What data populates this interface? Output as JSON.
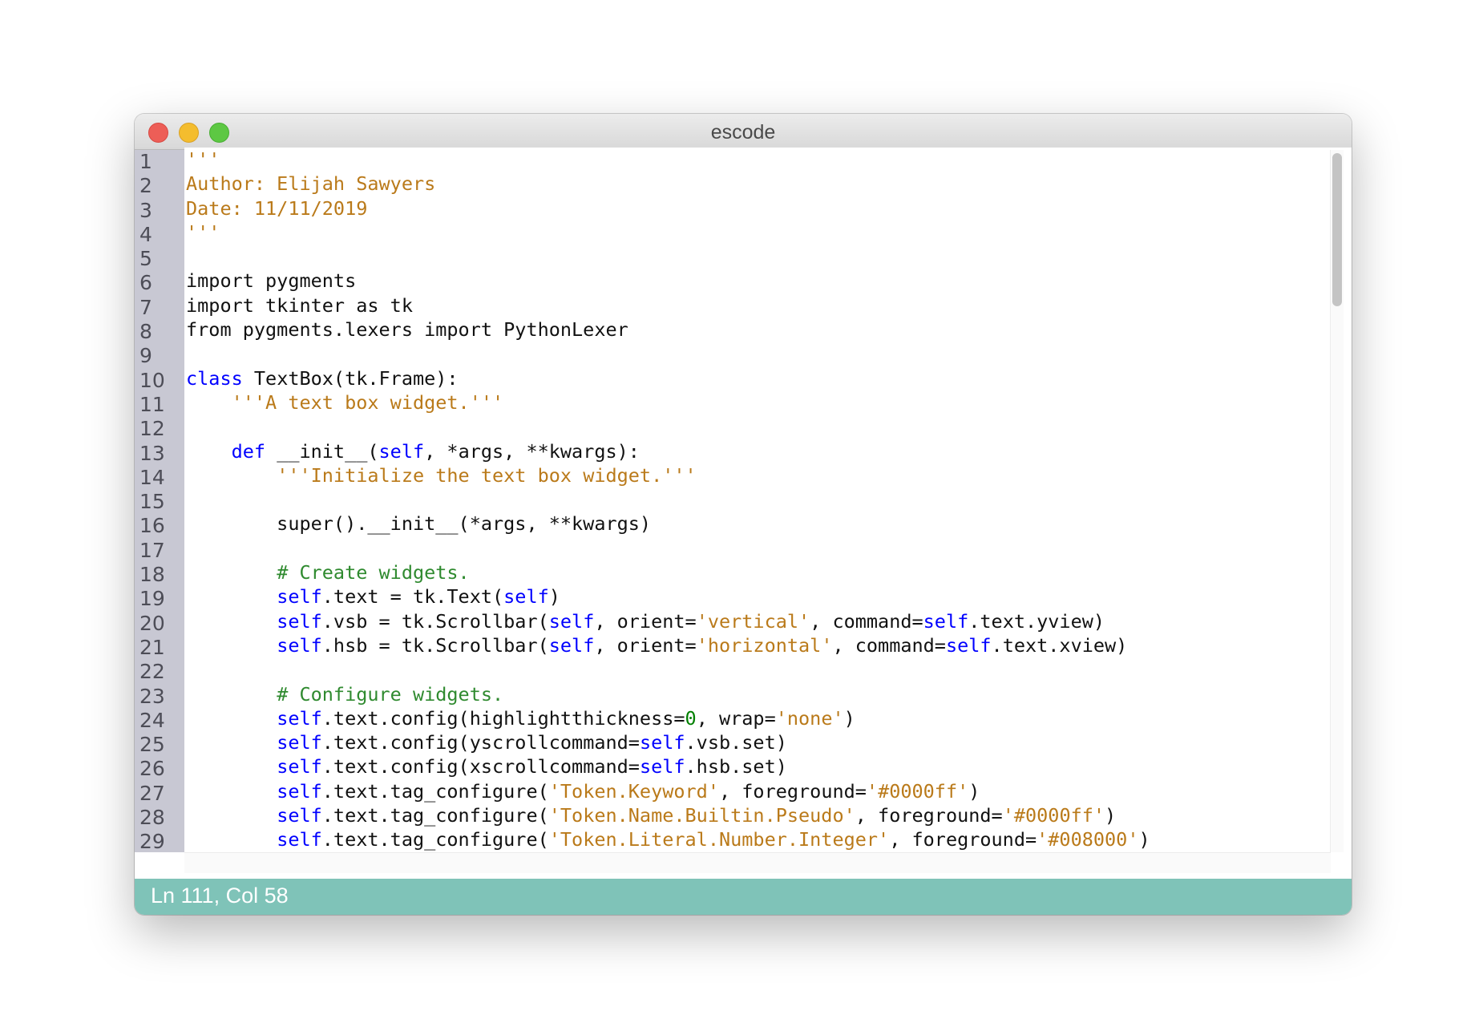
{
  "window": {
    "title": "escode"
  },
  "colors": {
    "keyword": "#0000ff",
    "string": "#ba7a1a",
    "comment": "#2f8a2f",
    "number": "#008000",
    "text": "#111111",
    "status_bar": "#7fc3b8"
  },
  "editor": {
    "line_numbers": [
      "1",
      "2",
      "3",
      "4",
      "5",
      "6",
      "7",
      "8",
      "9",
      "10",
      "11",
      "12",
      "13",
      "14",
      "15",
      "16",
      "17",
      "18",
      "19",
      "20",
      "21",
      "22",
      "23",
      "24",
      "25",
      "26",
      "27",
      "28",
      "29"
    ],
    "lines": [
      [
        {
          "t": "'''",
          "k": "string"
        }
      ],
      [
        {
          "t": "Author: Elijah Sawyers",
          "k": "string"
        }
      ],
      [
        {
          "t": "Date: 11/11/2019",
          "k": "string"
        }
      ],
      [
        {
          "t": "'''",
          "k": "string"
        }
      ],
      [],
      [
        {
          "t": "import pygments",
          "k": "text"
        }
      ],
      [
        {
          "t": "import tkinter as tk",
          "k": "text"
        }
      ],
      [
        {
          "t": "from pygments.lexers import PythonLexer",
          "k": "text"
        }
      ],
      [],
      [
        {
          "t": "class",
          "k": "keyword"
        },
        {
          "t": " TextBox(tk.Frame):",
          "k": "text"
        }
      ],
      [
        {
          "t": "    ",
          "k": "text"
        },
        {
          "t": "'''A text box widget.'''",
          "k": "string"
        }
      ],
      [],
      [
        {
          "t": "    ",
          "k": "text"
        },
        {
          "t": "def",
          "k": "keyword"
        },
        {
          "t": " __init__(",
          "k": "text"
        },
        {
          "t": "self",
          "k": "keyword"
        },
        {
          "t": ", *args, **kwargs):",
          "k": "text"
        }
      ],
      [
        {
          "t": "        ",
          "k": "text"
        },
        {
          "t": "'''Initialize the text box widget.'''",
          "k": "string"
        }
      ],
      [],
      [
        {
          "t": "        super().__init__(*args, **kwargs)",
          "k": "text"
        }
      ],
      [],
      [
        {
          "t": "        ",
          "k": "text"
        },
        {
          "t": "# Create widgets.",
          "k": "comment"
        }
      ],
      [
        {
          "t": "        ",
          "k": "text"
        },
        {
          "t": "self",
          "k": "keyword"
        },
        {
          "t": ".text = tk.Text(",
          "k": "text"
        },
        {
          "t": "self",
          "k": "keyword"
        },
        {
          "t": ")",
          "k": "text"
        }
      ],
      [
        {
          "t": "        ",
          "k": "text"
        },
        {
          "t": "self",
          "k": "keyword"
        },
        {
          "t": ".vsb = tk.Scrollbar(",
          "k": "text"
        },
        {
          "t": "self",
          "k": "keyword"
        },
        {
          "t": ", orient=",
          "k": "text"
        },
        {
          "t": "'vertical'",
          "k": "string"
        },
        {
          "t": ", command=",
          "k": "text"
        },
        {
          "t": "self",
          "k": "keyword"
        },
        {
          "t": ".text.yview)",
          "k": "text"
        }
      ],
      [
        {
          "t": "        ",
          "k": "text"
        },
        {
          "t": "self",
          "k": "keyword"
        },
        {
          "t": ".hsb = tk.Scrollbar(",
          "k": "text"
        },
        {
          "t": "self",
          "k": "keyword"
        },
        {
          "t": ", orient=",
          "k": "text"
        },
        {
          "t": "'horizontal'",
          "k": "string"
        },
        {
          "t": ", command=",
          "k": "text"
        },
        {
          "t": "self",
          "k": "keyword"
        },
        {
          "t": ".text.xview)",
          "k": "text"
        }
      ],
      [],
      [
        {
          "t": "        ",
          "k": "text"
        },
        {
          "t": "# Configure widgets.",
          "k": "comment"
        }
      ],
      [
        {
          "t": "        ",
          "k": "text"
        },
        {
          "t": "self",
          "k": "keyword"
        },
        {
          "t": ".text.config(highlightthickness=",
          "k": "text"
        },
        {
          "t": "0",
          "k": "number"
        },
        {
          "t": ", wrap=",
          "k": "text"
        },
        {
          "t": "'none'",
          "k": "string"
        },
        {
          "t": ")",
          "k": "text"
        }
      ],
      [
        {
          "t": "        ",
          "k": "text"
        },
        {
          "t": "self",
          "k": "keyword"
        },
        {
          "t": ".text.config(yscrollcommand=",
          "k": "text"
        },
        {
          "t": "self",
          "k": "keyword"
        },
        {
          "t": ".vsb.set)",
          "k": "text"
        }
      ],
      [
        {
          "t": "        ",
          "k": "text"
        },
        {
          "t": "self",
          "k": "keyword"
        },
        {
          "t": ".text.config(xscrollcommand=",
          "k": "text"
        },
        {
          "t": "self",
          "k": "keyword"
        },
        {
          "t": ".hsb.set)",
          "k": "text"
        }
      ],
      [
        {
          "t": "        ",
          "k": "text"
        },
        {
          "t": "self",
          "k": "keyword"
        },
        {
          "t": ".text.tag_configure(",
          "k": "text"
        },
        {
          "t": "'Token.Keyword'",
          "k": "string"
        },
        {
          "t": ", foreground=",
          "k": "text"
        },
        {
          "t": "'#0000ff'",
          "k": "string"
        },
        {
          "t": ")",
          "k": "text"
        }
      ],
      [
        {
          "t": "        ",
          "k": "text"
        },
        {
          "t": "self",
          "k": "keyword"
        },
        {
          "t": ".text.tag_configure(",
          "k": "text"
        },
        {
          "t": "'Token.Name.Builtin.Pseudo'",
          "k": "string"
        },
        {
          "t": ", foreground=",
          "k": "text"
        },
        {
          "t": "'#0000ff'",
          "k": "string"
        },
        {
          "t": ")",
          "k": "text"
        }
      ],
      [
        {
          "t": "        ",
          "k": "text"
        },
        {
          "t": "self",
          "k": "keyword"
        },
        {
          "t": ".text.tag_configure(",
          "k": "text"
        },
        {
          "t": "'Token.Literal.Number.Integer'",
          "k": "string"
        },
        {
          "t": ", foreground=",
          "k": "text"
        },
        {
          "t": "'#008000'",
          "k": "string"
        },
        {
          "t": ")",
          "k": "text"
        }
      ]
    ],
    "vertical_scroll": {
      "position_fraction": 0.0,
      "visible_fraction": 0.22
    }
  },
  "status_bar": {
    "text": "Ln 111, Col 58"
  }
}
